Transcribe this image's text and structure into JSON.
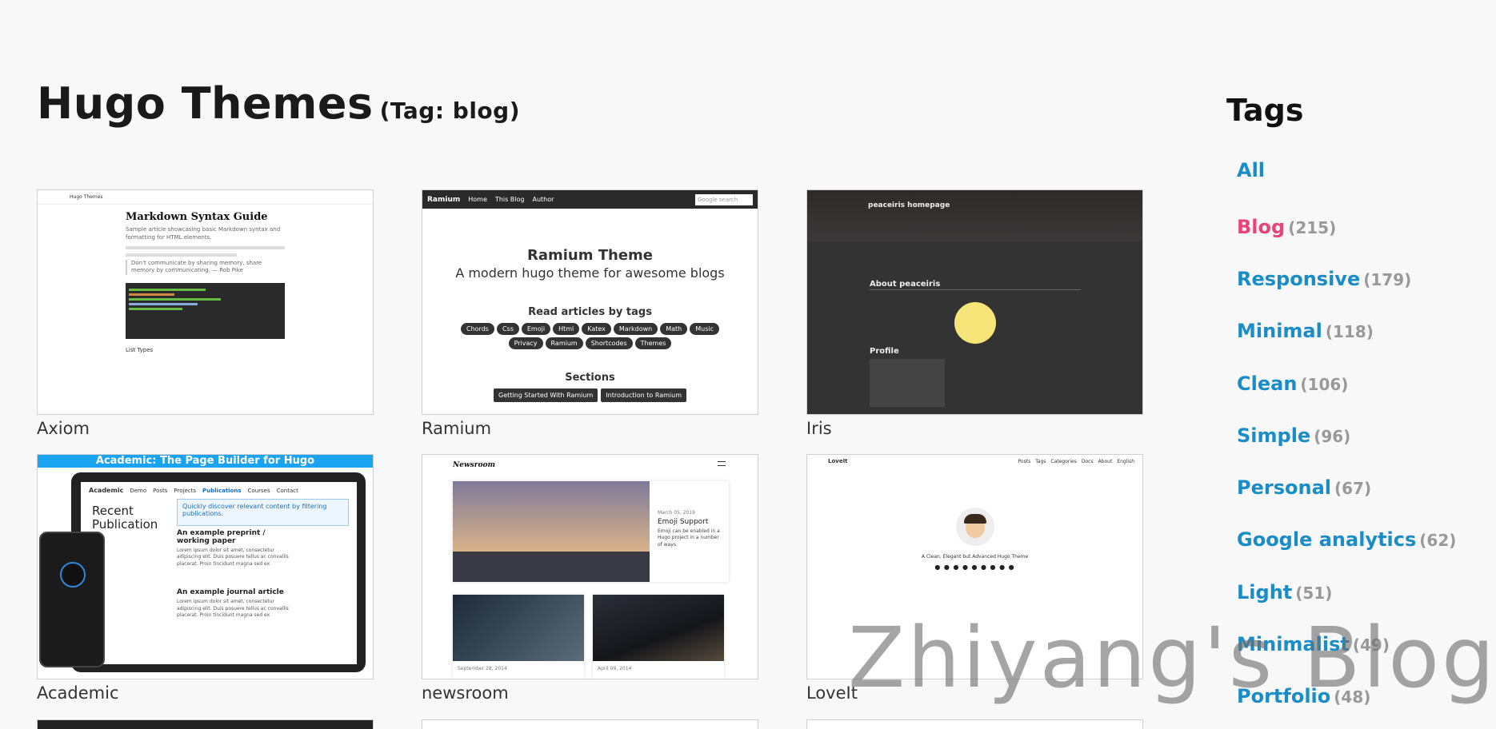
{
  "header": {
    "title": "Hugo Themes",
    "subtitle": "(Tag: blog)"
  },
  "themes": [
    {
      "name": "Axiom"
    },
    {
      "name": "Ramium"
    },
    {
      "name": "Iris"
    },
    {
      "name": "Academic"
    },
    {
      "name": "newsroom"
    },
    {
      "name": "LoveIt"
    }
  ],
  "thumbs": {
    "axiom": {
      "nav_brand": "Hugo Themes",
      "heading": "Markdown Syntax Guide",
      "summary": "Sample article showcasing basic Markdown syntax and formatting for HTML elements.",
      "quote": "Don't communicate by sharing memory, share memory by communicating. — Rob Pike",
      "footer": "List Types"
    },
    "ramium": {
      "brand": "Ramium",
      "nav": [
        "Home",
        "This Blog",
        "Author"
      ],
      "search_placeholder": "Google search",
      "title": "Ramium Theme",
      "subtitle": "A modern hugo theme for awesome blogs",
      "tags_heading": "Read articles by tags",
      "tags": [
        "Chords",
        "Css",
        "Emoji",
        "Html",
        "Katex",
        "Markdown",
        "Math",
        "Music",
        "Privacy",
        "Ramium",
        "Shortcodes",
        "Themes"
      ],
      "sections_heading": "Sections",
      "sections": [
        "Getting Started With Ramium",
        "Introduction to Ramium"
      ]
    },
    "iris": {
      "site": "peaceiris homepage",
      "about": "About peaceiris",
      "profile": "Profile"
    },
    "academic": {
      "banner": "Academic: The Page Builder for Hugo",
      "brand": "Academic",
      "nav": [
        "Demo",
        "Posts",
        "Projects",
        "Publications",
        "Courses",
        "Contact"
      ],
      "section": "Recent Publication",
      "info": "Quickly discover relevant content by filtering publications.",
      "article1": "An example preprint / working paper",
      "article2": "An example journal article",
      "lorem": "Lorem ipsum dolor sit amet, consectetur adipiscing elit. Duis posuere tellus ac convallis placerat. Proin tincidunt magna sed ex"
    },
    "newsroom": {
      "logo": "Newsroom",
      "date1": "March 05, 2019",
      "headline": "Emoji Support",
      "blurb": "Emoji can be enabled in a Hugo project in a number of ways.",
      "date2": "September 28, 2014",
      "date3": "April 09, 2014"
    },
    "lovelt": {
      "brand": "LoveIt",
      "nav": [
        "Posts",
        "Tags",
        "Categories",
        "Docs",
        "About",
        "English"
      ],
      "tagline": "A Clean, Elegant but Advanced Hugo Theme"
    }
  },
  "sidebar": {
    "title": "Tags",
    "tags": [
      {
        "label": "All",
        "count": ""
      },
      {
        "label": "Blog",
        "count": "(215)"
      },
      {
        "label": "Responsive",
        "count": "(179)"
      },
      {
        "label": "Minimal",
        "count": "(118)"
      },
      {
        "label": "Clean",
        "count": "(106)"
      },
      {
        "label": "Simple",
        "count": "(96)"
      },
      {
        "label": "Personal",
        "count": "(67)"
      },
      {
        "label": "Google analytics",
        "count": "(62)"
      },
      {
        "label": "Light",
        "count": "(51)"
      },
      {
        "label": "Minimalist",
        "count": "(49)"
      },
      {
        "label": "Portfolio",
        "count": "(48)"
      }
    ]
  },
  "watermark": "Zhiyang's Blog",
  "colors": {
    "tag_link": "#1a8cc8",
    "tag_active": "#e8437a",
    "count": "#999999"
  }
}
